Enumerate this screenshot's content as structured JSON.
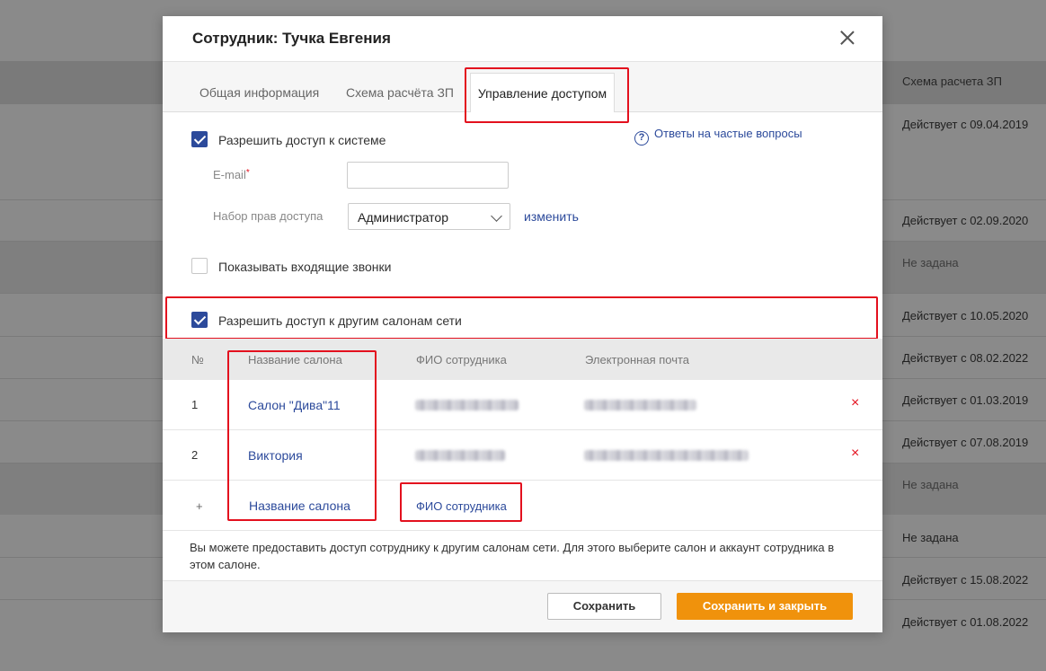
{
  "background": {
    "column_header": "Схема расчета ЗП",
    "rows": [
      "Действует с 09.04.2019",
      "Действует с 02.09.2020",
      "Не задана",
      "Действует с 10.05.2020",
      "Действует с 08.02.2022",
      "Действует с 01.03.2019",
      "Действует с 07.08.2019",
      "Не задана",
      "Не задана",
      "Действует с 15.08.2022",
      "Действует с 01.08.2022"
    ]
  },
  "modal": {
    "title": "Сотрудник: Тучка Евгения",
    "tabs": [
      {
        "label": "Общая информация",
        "active": false
      },
      {
        "label": "Схема расчёта ЗП",
        "active": false
      },
      {
        "label": "Управление доступом",
        "active": true
      }
    ],
    "allow_system_access": {
      "label": "Разрешить доступ к системе",
      "checked": true
    },
    "faq_link": "Ответы на частые вопросы",
    "faq_icon": "?",
    "email": {
      "label": "E-mail",
      "required_mark": "*",
      "value": "",
      "placeholder": ""
    },
    "access_set": {
      "label": "Набор прав доступа",
      "value": "Администратор",
      "change_link": "изменить"
    },
    "show_calls": {
      "label": "Показывать входящие звонки",
      "checked": false
    },
    "allow_network_access": {
      "label": "Разрешить доступ к другим салонам сети",
      "checked": true
    },
    "table": {
      "headers": {
        "num": "№",
        "salon": "Название салона",
        "employee": "ФИО сотрудника",
        "email": "Электронная почта"
      },
      "rows": [
        {
          "num": "1",
          "salon": "Салон \"Дива\"11",
          "delete": "×"
        },
        {
          "num": "2",
          "salon": "Виктория",
          "delete": "×"
        }
      ],
      "add_row": {
        "plus": "+",
        "salon_link": "Название салона",
        "employee_link": "ФИО сотрудника"
      }
    },
    "info_text": "Вы можете предоставить доступ сотруднику к другим салонам сети. Для этого выберите салон и аккаунт сотрудника в этом салоне.",
    "buttons": {
      "save": "Сохранить",
      "save_close": "Сохранить и закрыть"
    }
  },
  "colors": {
    "accent_blue": "#2c4a9b",
    "orange": "#f0920c",
    "highlight_red": "#e3101e"
  }
}
